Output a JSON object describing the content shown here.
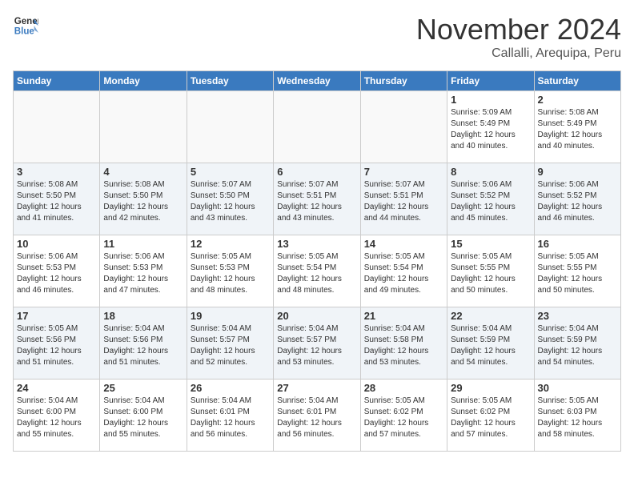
{
  "header": {
    "logo_line1": "General",
    "logo_line2": "Blue",
    "month": "November 2024",
    "location": "Callalli, Arequipa, Peru"
  },
  "weekdays": [
    "Sunday",
    "Monday",
    "Tuesday",
    "Wednesday",
    "Thursday",
    "Friday",
    "Saturday"
  ],
  "weeks": [
    [
      {
        "day": null
      },
      {
        "day": null
      },
      {
        "day": null
      },
      {
        "day": null
      },
      {
        "day": null
      },
      {
        "day": "1",
        "sunrise": "5:09 AM",
        "sunset": "5:49 PM",
        "daylight": "12 hours and 40 minutes."
      },
      {
        "day": "2",
        "sunrise": "5:08 AM",
        "sunset": "5:49 PM",
        "daylight": "12 hours and 40 minutes."
      }
    ],
    [
      {
        "day": "3",
        "sunrise": "5:08 AM",
        "sunset": "5:50 PM",
        "daylight": "12 hours and 41 minutes."
      },
      {
        "day": "4",
        "sunrise": "5:08 AM",
        "sunset": "5:50 PM",
        "daylight": "12 hours and 42 minutes."
      },
      {
        "day": "5",
        "sunrise": "5:07 AM",
        "sunset": "5:50 PM",
        "daylight": "12 hours and 43 minutes."
      },
      {
        "day": "6",
        "sunrise": "5:07 AM",
        "sunset": "5:51 PM",
        "daylight": "12 hours and 43 minutes."
      },
      {
        "day": "7",
        "sunrise": "5:07 AM",
        "sunset": "5:51 PM",
        "daylight": "12 hours and 44 minutes."
      },
      {
        "day": "8",
        "sunrise": "5:06 AM",
        "sunset": "5:52 PM",
        "daylight": "12 hours and 45 minutes."
      },
      {
        "day": "9",
        "sunrise": "5:06 AM",
        "sunset": "5:52 PM",
        "daylight": "12 hours and 46 minutes."
      }
    ],
    [
      {
        "day": "10",
        "sunrise": "5:06 AM",
        "sunset": "5:53 PM",
        "daylight": "12 hours and 46 minutes."
      },
      {
        "day": "11",
        "sunrise": "5:06 AM",
        "sunset": "5:53 PM",
        "daylight": "12 hours and 47 minutes."
      },
      {
        "day": "12",
        "sunrise": "5:05 AM",
        "sunset": "5:53 PM",
        "daylight": "12 hours and 48 minutes."
      },
      {
        "day": "13",
        "sunrise": "5:05 AM",
        "sunset": "5:54 PM",
        "daylight": "12 hours and 48 minutes."
      },
      {
        "day": "14",
        "sunrise": "5:05 AM",
        "sunset": "5:54 PM",
        "daylight": "12 hours and 49 minutes."
      },
      {
        "day": "15",
        "sunrise": "5:05 AM",
        "sunset": "5:55 PM",
        "daylight": "12 hours and 50 minutes."
      },
      {
        "day": "16",
        "sunrise": "5:05 AM",
        "sunset": "5:55 PM",
        "daylight": "12 hours and 50 minutes."
      }
    ],
    [
      {
        "day": "17",
        "sunrise": "5:05 AM",
        "sunset": "5:56 PM",
        "daylight": "12 hours and 51 minutes."
      },
      {
        "day": "18",
        "sunrise": "5:04 AM",
        "sunset": "5:56 PM",
        "daylight": "12 hours and 51 minutes."
      },
      {
        "day": "19",
        "sunrise": "5:04 AM",
        "sunset": "5:57 PM",
        "daylight": "12 hours and 52 minutes."
      },
      {
        "day": "20",
        "sunrise": "5:04 AM",
        "sunset": "5:57 PM",
        "daylight": "12 hours and 53 minutes."
      },
      {
        "day": "21",
        "sunrise": "5:04 AM",
        "sunset": "5:58 PM",
        "daylight": "12 hours and 53 minutes."
      },
      {
        "day": "22",
        "sunrise": "5:04 AM",
        "sunset": "5:59 PM",
        "daylight": "12 hours and 54 minutes."
      },
      {
        "day": "23",
        "sunrise": "5:04 AM",
        "sunset": "5:59 PM",
        "daylight": "12 hours and 54 minutes."
      }
    ],
    [
      {
        "day": "24",
        "sunrise": "5:04 AM",
        "sunset": "6:00 PM",
        "daylight": "12 hours and 55 minutes."
      },
      {
        "day": "25",
        "sunrise": "5:04 AM",
        "sunset": "6:00 PM",
        "daylight": "12 hours and 55 minutes."
      },
      {
        "day": "26",
        "sunrise": "5:04 AM",
        "sunset": "6:01 PM",
        "daylight": "12 hours and 56 minutes."
      },
      {
        "day": "27",
        "sunrise": "5:04 AM",
        "sunset": "6:01 PM",
        "daylight": "12 hours and 56 minutes."
      },
      {
        "day": "28",
        "sunrise": "5:05 AM",
        "sunset": "6:02 PM",
        "daylight": "12 hours and 57 minutes."
      },
      {
        "day": "29",
        "sunrise": "5:05 AM",
        "sunset": "6:02 PM",
        "daylight": "12 hours and 57 minutes."
      },
      {
        "day": "30",
        "sunrise": "5:05 AM",
        "sunset": "6:03 PM",
        "daylight": "12 hours and 58 minutes."
      }
    ]
  ]
}
